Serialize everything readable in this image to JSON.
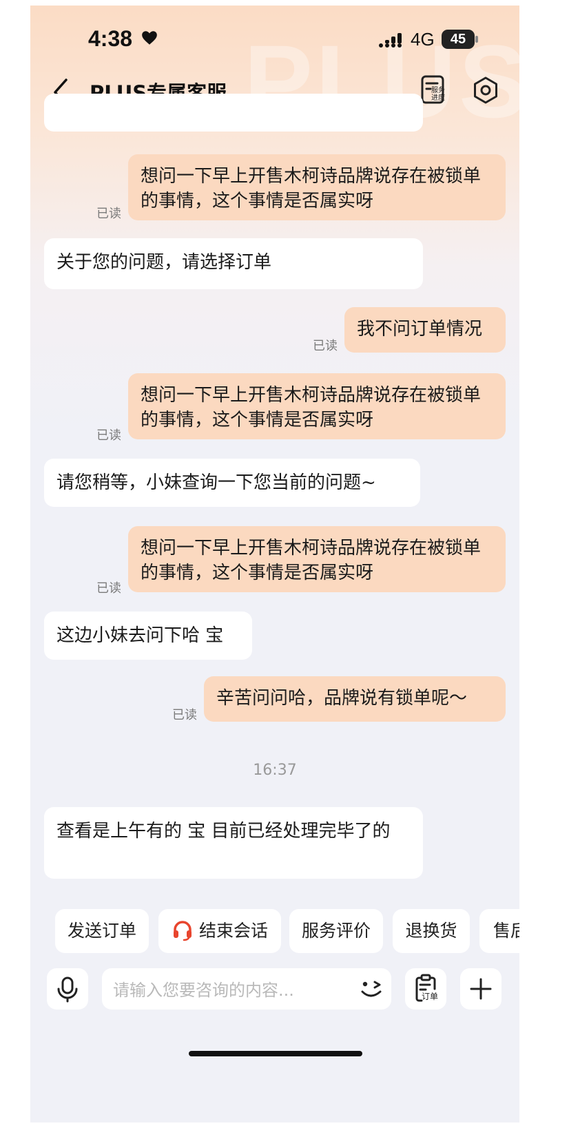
{
  "status_bar": {
    "time": "4:38",
    "network": "4G",
    "battery": "45"
  },
  "header": {
    "title": "PLUS专属客服",
    "progress_label": "服务进度",
    "watermark": "PLUS"
  },
  "messages": {
    "m1": "想问一下早上开售木柯诗品牌说存在被锁单的事情，这个事情是否属实呀",
    "m2": "关于您的问题，请选择订单",
    "m3": "我不问订单情况",
    "m4": "想问一下早上开售木柯诗品牌说存在被锁单的事情，这个事情是否属实呀",
    "m5": "请您稍等，小妹查询一下您当前的问题~",
    "m6": "想问一下早上开售木柯诗品牌说存在被锁单的事情，这个事情是否属实呀",
    "m7": "这边小妹去问下哈 宝",
    "m8": "辛苦问问哈，品牌说有锁单呢～",
    "m9": "查看是上午有的 宝 目前已经处理完毕了的"
  },
  "read_label": "已读",
  "timestamp": "16:37",
  "quick_replies": [
    "发送订单",
    "结束会话",
    "服务评价",
    "退换货",
    "售后"
  ],
  "input": {
    "placeholder": "请输入您要咨询的内容...",
    "order_label": "订单"
  },
  "colors": {
    "user_bubble": "#fbd9c0",
    "agent_bubble": "#ffffff",
    "accent": "#e8452e"
  }
}
